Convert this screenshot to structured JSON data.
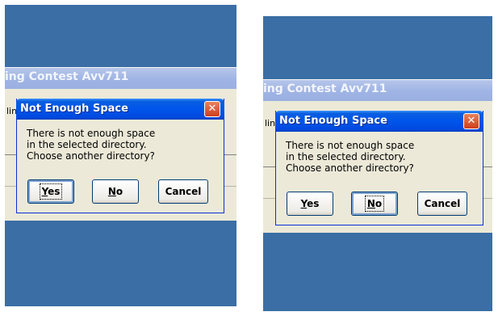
{
  "background_window": {
    "title_fragment": "ing Contest Avv711",
    "label_fragment": "lin"
  },
  "dialog": {
    "title": "Not Enough Space",
    "close_glyph": "✕",
    "message_lines": [
      "There is not enough space",
      "in the selected directory.",
      "Choose another directory?"
    ],
    "buttons": {
      "yes": {
        "mnemonic": "Y",
        "rest": "es"
      },
      "no": {
        "mnemonic": "N",
        "rest": "o"
      },
      "cancel": "Cancel"
    }
  },
  "screens": [
    {
      "id": "left",
      "focused_button": "yes"
    },
    {
      "id": "right",
      "focused_button": "no"
    }
  ],
  "colors": {
    "desktop": "#3a6ea5",
    "titlebar": "#0055ea",
    "dialog_face": "#ece9d8",
    "close": "#cf3e1d"
  }
}
